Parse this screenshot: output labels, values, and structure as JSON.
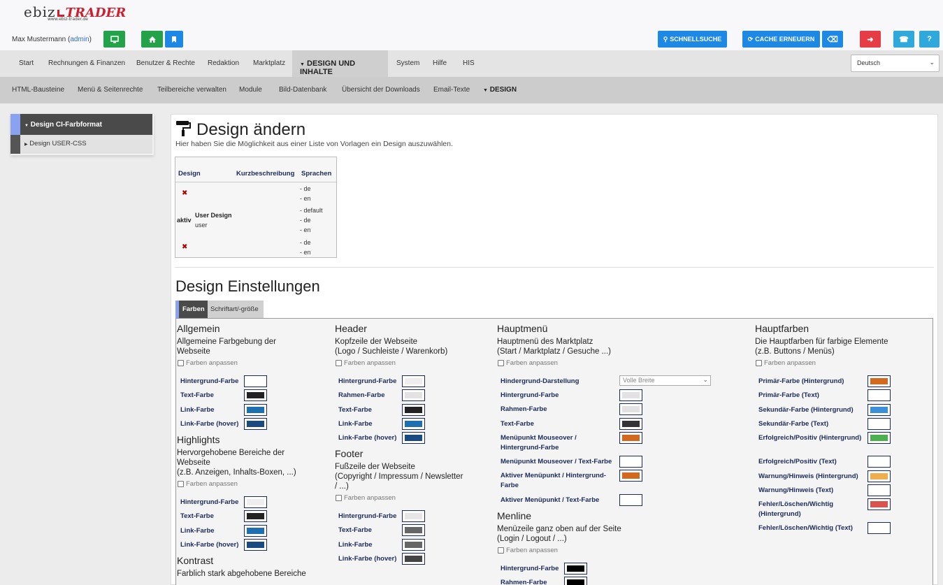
{
  "logo": {
    "brand_a": "ebiz",
    "brand_b": "TRADER",
    "url": "www.ebiz-trader.de"
  },
  "user": {
    "name": "Max Mustermann",
    "role": "admin"
  },
  "toolbar": {
    "quicksearch": "SCHNELLSUCHE",
    "cache": "CACHE ERNEUERN"
  },
  "nav_main": [
    "Start",
    "Rechnungen & Finanzen",
    "Benutzer & Rechte",
    "Redaktion",
    "Marktplatz",
    "DESIGN UND INHALTE",
    "System",
    "Hilfe",
    "HIS"
  ],
  "language": "Deutsch",
  "nav_sub": [
    "HTML-Bausteine",
    "Menü & Seitenrechte",
    "Teilbereiche verwalten",
    "Module",
    "Bild-Datenbank",
    "Übersicht der Downloads",
    "Email-Texte",
    "DESIGN"
  ],
  "sidebar": [
    "Design CI-Farbformat",
    "Design USER-CSS"
  ],
  "page": {
    "title": "Design ändern",
    "subtitle": "Hier haben Sie die Möglichkeit aus einer Liste von Vorlagen ein Design auszuwählen.",
    "settings_title": "Design Einstellungen"
  },
  "design_table": {
    "headers": [
      "Design",
      "Kurzbeschreibung",
      "Sprachen"
    ],
    "rows": [
      {
        "status": "",
        "name": "",
        "desc": "",
        "langs": [
          "- de",
          "- en"
        ]
      },
      {
        "status": "aktiv",
        "name": "User Design",
        "desc": "user",
        "langs": [
          "- default",
          "- de",
          "- en"
        ]
      },
      {
        "status": "",
        "name": "",
        "desc": "",
        "langs": [
          "- de",
          "- en"
        ]
      }
    ]
  },
  "tabs": [
    "Farben",
    "Schriftart/-größe"
  ],
  "checkbox_label": "Farben anpassen",
  "sections": {
    "allgemein": {
      "title": "Allgemein",
      "desc": [
        "Allgemeine Farbgebung der",
        "Webseite"
      ],
      "items": [
        {
          "label": "Hintergrund-Farbe",
          "color": "#ffffff"
        },
        {
          "label": "Text-Farbe",
          "color": "#222222"
        },
        {
          "label": "Link-Farbe",
          "color": "#1e6fb0"
        },
        {
          "label": "Link-Farbe (hover)",
          "color": "#1a4a82"
        }
      ]
    },
    "highlights": {
      "title": "Highlights",
      "desc": [
        "Hervorgehobene Bereiche der",
        "Webseite",
        "(z.B. Anzeigen, Inhalts-Boxen, ...)"
      ],
      "items": [
        {
          "label": "Hintergrund-Farbe",
          "color": "#eeeeee"
        },
        {
          "label": "Text-Farbe",
          "color": "#222222"
        },
        {
          "label": "Link-Farbe",
          "color": "#1e6fb0"
        },
        {
          "label": "Link-Farbe (hover)",
          "color": "#1a4a82"
        }
      ]
    },
    "kontrast": {
      "title": "Kontrast",
      "desc": [
        "Farblich stark abgehobene Bereiche"
      ]
    },
    "header": {
      "title": "Header",
      "desc": [
        "Kopfzeile der Webseite",
        "(Logo / Suchleiste / Warenkorb)"
      ],
      "items": [
        {
          "label": "Hintergrund-Farbe",
          "color": "#eeeeee"
        },
        {
          "label": "Rahmen-Farbe",
          "color": "#e2e2e2"
        },
        {
          "label": "Text-Farbe",
          "color": "#222222"
        },
        {
          "label": "Link-Farbe",
          "color": "#1e6fb0"
        },
        {
          "label": "Link-Farbe (hover)",
          "color": "#1a4a82"
        }
      ]
    },
    "footer": {
      "title": "Footer",
      "desc": [
        "Fußzeile der Webseite",
        "(Copyright / Impressum / Newsletter",
        "/ ...)"
      ],
      "items": [
        {
          "label": "Hintergrund-Farbe",
          "color": "#e6e6e6"
        },
        {
          "label": "Text-Farbe",
          "color": "#666666"
        },
        {
          "label": "Link-Farbe",
          "color": "#666666"
        },
        {
          "label": "Link-Farbe (hover)",
          "color": "#444444"
        }
      ]
    },
    "hauptmenu": {
      "title": "Hauptmenü",
      "desc": [
        "Hauptmenü des Marktplatz",
        "(Start / Marktplatz / Gesuche ...)"
      ],
      "select_label": "Hindergrund-Darstellung",
      "select_value": "Volle Breite",
      "items": [
        {
          "label": "Hintergrund-Farbe",
          "color": "#e2e2e2"
        },
        {
          "label": "Rahmen-Farbe",
          "color": "#e2e2e2"
        },
        {
          "label": "Text-Farbe",
          "color": "#333333"
        },
        {
          "label": "Menüpunkt Mouseover / Hintergrund-Farbe",
          "color": "#d2691e"
        },
        {
          "label": "Menüpunkt Mouseover / Text-Farbe",
          "color": "#ffffff"
        },
        {
          "label": "Aktiver Menüpunkt / Hintergrund-Farbe",
          "color": "#d2691e"
        },
        {
          "label": "Aktiver Menüpunkt / Text-Farbe",
          "color": "#ffffff"
        }
      ]
    },
    "menline": {
      "title": "Menline",
      "desc": [
        "Menüzeile ganz oben auf der Seite",
        "(Login / Logout / ...)"
      ],
      "items": [
        {
          "label": "Hintergrund-Farbe",
          "color": "#000000"
        },
        {
          "label": "Rahmen-Farbe",
          "color": "#000000"
        }
      ]
    },
    "hauptfarben": {
      "title": "Hauptfarben",
      "desc": [
        "Die Hauptfarben für farbige Elemente",
        "(z.B. Buttons / Menüs)"
      ],
      "items": [
        {
          "label": "Primär-Farbe (Hintergrund)",
          "color": "#d2691e"
        },
        {
          "label": "Primär-Farbe (Text)",
          "color": "#ffffff"
        },
        {
          "label": "Sekundär-Farbe (Hintergrund)",
          "color": "#3b8fd9"
        },
        {
          "label": "Sekundär-Farbe (Text)",
          "color": "#ffffff"
        },
        {
          "label": "Erfolgreich/Positiv (Hintergrund)",
          "color": "#4caf50"
        },
        {
          "label": "Erfolgreich/Positiv (Text)",
          "color": "#ffffff"
        },
        {
          "label": "Warnung/Hinweis (Hintergrund)",
          "color": "#f0ad4e"
        },
        {
          "label": "Warnung/Hinweis (Text)",
          "color": "#ffffff"
        },
        {
          "label": "Fehler/Löschen/Wichtig (Hintergrund)",
          "color": "#d9534f"
        },
        {
          "label": "Fehler/Löschen/Wichtig (Text)",
          "color": "#ffffff"
        }
      ]
    }
  }
}
